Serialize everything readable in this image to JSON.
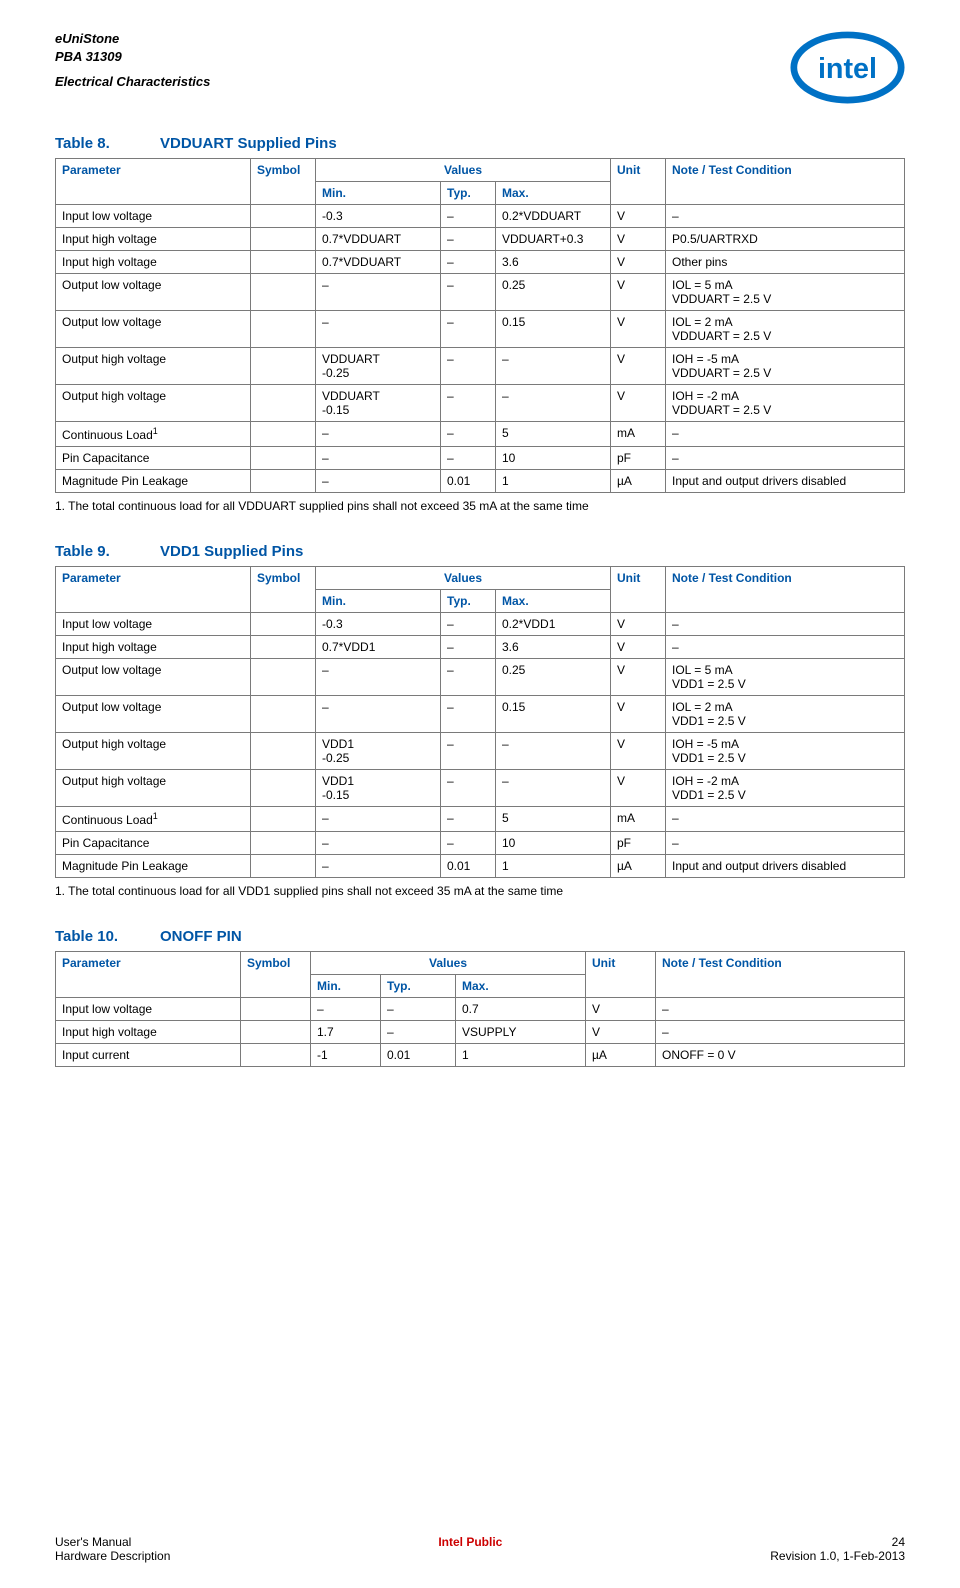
{
  "header": {
    "product1": "eUniStone",
    "product2": "PBA 31309",
    "section": "Electrical Characteristics"
  },
  "tables": [
    {
      "caption_num": "Table 8.",
      "caption_title": "VDDUART Supplied Pins",
      "col_widths": [
        "param",
        "sym",
        "min",
        "typ",
        "max",
        "unit",
        "note"
      ],
      "head": {
        "parameter": "Parameter",
        "symbol": "Symbol",
        "values": "Values",
        "min": "Min.",
        "typ": "Typ.",
        "max": "Max.",
        "unit": "Unit",
        "note": "Note / Test Condition"
      },
      "rows": [
        {
          "p": "Input low voltage",
          "s": "",
          "min": "-0.3",
          "typ": "–",
          "max": "0.2*VDDUART",
          "u": "V",
          "n": "–"
        },
        {
          "p": "Input high voltage",
          "s": "",
          "min": "0.7*VDDUART",
          "typ": "–",
          "max": "VDDUART+0.3",
          "u": "V",
          "n": "P0.5/UARTRXD"
        },
        {
          "p": "Input high voltage",
          "s": "",
          "min": "0.7*VDDUART",
          "typ": "–",
          "max": "3.6",
          "u": "V",
          "n": "Other pins"
        },
        {
          "p": "Output low voltage",
          "s": "",
          "min": "–",
          "typ": "–",
          "max": "0.25",
          "u": "V",
          "n": "IOL = 5 mA\nVDDUART = 2.5 V"
        },
        {
          "p": "Output low voltage",
          "s": "",
          "min": "–",
          "typ": "–",
          "max": "0.15",
          "u": "V",
          "n": "IOL = 2 mA\nVDDUART = 2.5 V"
        },
        {
          "p": "Output high voltage",
          "s": "",
          "min": "VDDUART\n-0.25",
          "typ": "–",
          "max": "–",
          "u": "V",
          "n": "IOH = -5 mA\nVDDUART = 2.5 V"
        },
        {
          "p": "Output high voltage",
          "s": "",
          "min": "VDDUART\n-0.15",
          "typ": "–",
          "max": "–",
          "u": "V",
          "n": "IOH = -2 mA\nVDDUART = 2.5 V"
        },
        {
          "p": "Continuous Load",
          "sup": "1",
          "s": "",
          "min": "–",
          "typ": "–",
          "max": "5",
          "u": "mA",
          "n": "–"
        },
        {
          "p": "Pin Capacitance",
          "s": "",
          "min": "–",
          "typ": "–",
          "max": "10",
          "u": "pF",
          "n": "–"
        },
        {
          "p": "Magnitude Pin Leakage",
          "s": "",
          "min": "–",
          "typ": "0.01",
          "max": "1",
          "u": "µA",
          "n": "Input and output drivers disabled"
        }
      ],
      "foot": "1.  The total continuous load for all VDDUART supplied pins shall not exceed 35 mA at the same time"
    },
    {
      "caption_num": "Table 9.",
      "caption_title": "VDD1 Supplied Pins",
      "head": {
        "parameter": "Parameter",
        "symbol": "Symbol",
        "values": "Values",
        "min": "Min.",
        "typ": "Typ.",
        "max": "Max.",
        "unit": "Unit",
        "note": "Note / Test Condition"
      },
      "rows": [
        {
          "p": "Input low voltage",
          "s": "",
          "min": "-0.3",
          "typ": "–",
          "max": "0.2*VDD1",
          "u": "V",
          "n": "–"
        },
        {
          "p": "Input high voltage",
          "s": "",
          "min": "0.7*VDD1",
          "typ": "–",
          "max": "3.6",
          "u": "V",
          "n": "–"
        },
        {
          "p": "Output low voltage",
          "s": "",
          "min": "–",
          "typ": "–",
          "max": "0.25",
          "u": "V",
          "n": "IOL = 5 mA\nVDD1 = 2.5 V"
        },
        {
          "p": "Output low voltage",
          "s": "",
          "min": "–",
          "typ": "–",
          "max": "0.15",
          "u": "V",
          "n": "IOL = 2 mA\nVDD1 = 2.5 V"
        },
        {
          "p": "Output high voltage",
          "s": "",
          "min": "VDD1\n-0.25",
          "typ": "–",
          "max": "–",
          "u": "V",
          "n": "IOH = -5 mA\nVDD1 = 2.5 V"
        },
        {
          "p": "Output high voltage",
          "s": "",
          "min": "VDD1\n-0.15",
          "typ": "–",
          "max": "–",
          "u": "V",
          "n": "IOH = -2 mA\nVDD1 = 2.5 V"
        },
        {
          "p": "Continuous Load",
          "sup": "1",
          "s": "",
          "min": "–",
          "typ": "–",
          "max": "5",
          "u": "mA",
          "n": "–"
        },
        {
          "p": "Pin Capacitance",
          "s": "",
          "min": "–",
          "typ": "–",
          "max": "10",
          "u": "pF",
          "n": "–"
        },
        {
          "p": "Magnitude Pin Leakage",
          "s": "",
          "min": "–",
          "typ": "0.01",
          "max": "1",
          "u": "µA",
          "n": "Input and output drivers disabled"
        }
      ],
      "foot": "1.  The total continuous load for all VDD1 supplied pins shall not exceed 35 mA at the same time"
    },
    {
      "caption_num": "Table 10.",
      "caption_title": "ONOFF PIN",
      "narrow": true,
      "head": {
        "parameter": "Parameter",
        "symbol": "Symbol",
        "values": "Values",
        "min": "Min.",
        "typ": "Typ.",
        "max": "Max.",
        "unit": "Unit",
        "note": "Note / Test Condition"
      },
      "rows": [
        {
          "p": "Input low voltage",
          "s": "",
          "min": "–",
          "typ": "–",
          "max": "0.7",
          "u": "V",
          "n": "–"
        },
        {
          "p": "Input high voltage",
          "s": "",
          "min": "1.7",
          "typ": "–",
          "max": "VSUPPLY",
          "u": "V",
          "n": "–"
        },
        {
          "p": "Input current",
          "s": "",
          "min": "-1",
          "typ": "0.01",
          "max": "1",
          "u": "µA",
          "n": "ONOFF = 0 V"
        }
      ]
    }
  ],
  "footer": {
    "l1": "User's Manual",
    "l2": "Hardware Description",
    "mid": "Intel Public",
    "r1": "24",
    "r2": "Revision 1.0, 1-Feb-2013"
  }
}
